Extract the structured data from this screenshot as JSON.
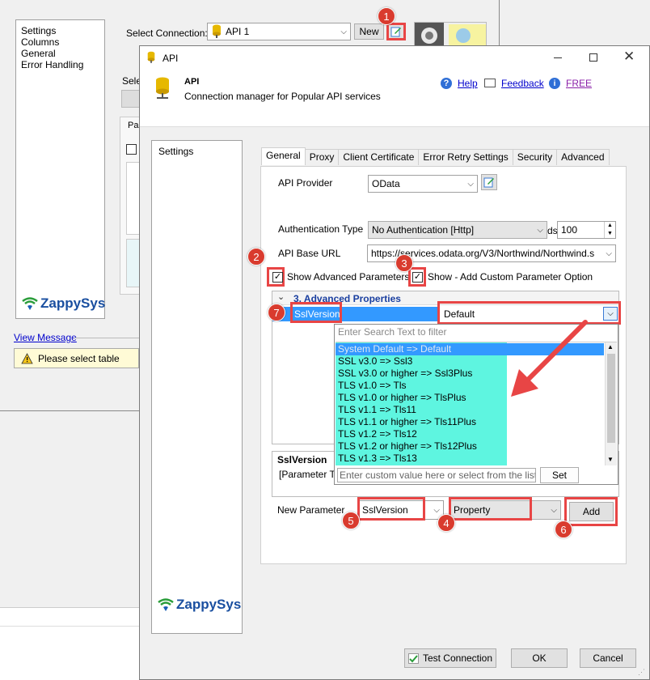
{
  "background_window": {
    "nav_items": [
      "Settings",
      "Columns",
      "General",
      "Error Handling"
    ],
    "select_connection_label": "Select Connection:",
    "select_connection_value": "API 1",
    "new_button": "New",
    "partial_label_sele": "Sele",
    "partial_tab_par": "Par",
    "view_message_link": "View Message",
    "warning_text": "Please select table",
    "logo_text": "ZappySys"
  },
  "dialog": {
    "window_title": "API",
    "header_title": "API",
    "header_subtitle": "Connection manager for Popular API services",
    "help_link": "Help",
    "feedback_link": "Feedback",
    "free_link": "FREE",
    "left_nav_items": [
      "Settings"
    ],
    "logo_text": "ZappySys",
    "tabs": [
      "General",
      "Proxy",
      "Client Certificate",
      "Error Retry Settings",
      "Security",
      "Advanced"
    ],
    "api_provider_label": "API Provider",
    "api_provider_value": "OData",
    "auth_type_label": "Authentication Type",
    "auth_type_value": "No Authentication [Http]",
    "timeout_suffix": "ds)",
    "timeout_value": "100",
    "base_url_label": "API Base URL",
    "base_url_value": "https://services.odata.org/V3/Northwind/Northwind.s",
    "show_advanced_label": "Show Advanced Parameters",
    "show_custom_label": "Show - Add Custom Parameter Option",
    "advanced_section_title": "3. Advanced Properties",
    "property_name": "SslVersion",
    "property_value": "Default",
    "filter_placeholder": "Enter Search Text to filter",
    "dropdown_options": [
      "System Default => Default",
      "SSL v3.0 => Ssl3",
      "SSL v3.0 or higher => Ssl3Plus",
      "TLS v1.0 => Tls",
      "TLS v1.0 or higher => TlsPlus",
      "TLS v1.1 => Tls11",
      "TLS v1.1 or higher => Tls11Plus",
      "TLS v1.2 => Tls12",
      "TLS v1.2 or higher => Tls12Plus",
      "TLS v1.3 => Tls13"
    ],
    "custom_value_placeholder": "Enter custom value here or select from the list",
    "set_button": "Set",
    "desc_title": "SslVersion",
    "desc_text": "[Parameter T",
    "new_parameter_label": "New Parameter",
    "new_parameter_name": "SslVersion",
    "new_parameter_type": "Property",
    "add_button": "Add",
    "test_connection_button": "Test Connection",
    "ok_button": "OK",
    "cancel_button": "Cancel"
  },
  "annotations": {
    "badges": [
      "1",
      "2",
      "3",
      "4",
      "5",
      "6",
      "7"
    ],
    "highlight_color": "#e84545",
    "badge_color": "#d93b2e",
    "dropdown_highlight_color": "#5ef5e0"
  }
}
